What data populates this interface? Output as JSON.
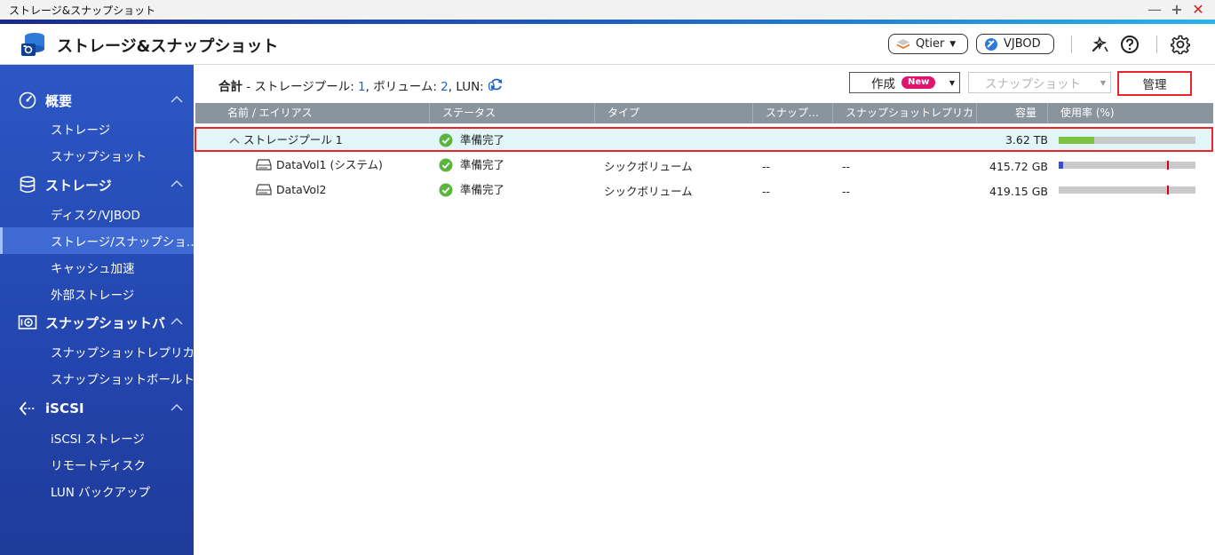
{
  "window": {
    "title": "ストレージ&スナップショット",
    "controls": [
      "minimize-icon",
      "maximize-icon",
      "close-icon"
    ]
  },
  "header": {
    "app_title": "ストレージ&スナップショット",
    "qtier_label": "Qtier",
    "vjbod_label": "VJBOD",
    "icons": [
      "app-logo-icon",
      "tools-icon",
      "help-icon",
      "settings-icon"
    ]
  },
  "sidebar": {
    "sections": [
      {
        "label": "概要",
        "icon": "gauge-icon",
        "items": [
          "ストレージ",
          "スナップショット"
        ]
      },
      {
        "label": "ストレージ",
        "icon": "database-icon",
        "items": [
          "ディスク/VJBOD",
          "ストレージ/スナップショ…",
          "キャッシュ加速",
          "外部ストレージ"
        ]
      },
      {
        "label": "スナップショットバ",
        "icon": "snapshot-vault-icon",
        "items": [
          "スナップショットレプリカ",
          "スナップショットボールト"
        ]
      },
      {
        "label": "iSCSI",
        "icon": "iscsi-icon",
        "items": [
          "iSCSI ストレージ",
          "リモートディスク",
          "LUN バックアップ"
        ]
      }
    ],
    "active_item": "ストレージ/スナップショ…"
  },
  "toolbar": {
    "summary_title": "合計",
    "summary_dash": " - ",
    "pool_label": "ストレージプール: ",
    "pool_count": "1",
    "volume_label": ", ボリューム: ",
    "volume_count": "2",
    "lun_label": ", LUN: ",
    "lun_count": "0",
    "create_label": "作成",
    "new_badge": "New",
    "snapshot_label": "スナップショット",
    "manage_label": "管理"
  },
  "table": {
    "columns": [
      "名前 / エイリアス",
      "ステータス",
      "タイプ",
      "スナップ…",
      "スナップショットレプリカ",
      "容量",
      "使用率 (%)"
    ],
    "rows": [
      {
        "kind": "pool",
        "name": "ストレージプール 1",
        "status": "準備完了",
        "type": "",
        "snapshot": "",
        "replica": "",
        "capacity": "3.62 TB",
        "usage": 0.26
      },
      {
        "kind": "volume",
        "name": "DataVol1 (システム)",
        "status": "準備完了",
        "type": "シックボリューム",
        "snapshot": "--",
        "replica": "--",
        "capacity": "415.72 GB",
        "usage": 0.03
      },
      {
        "kind": "volume",
        "name": "DataVol2",
        "status": "準備完了",
        "type": "シックボリューム",
        "snapshot": "--",
        "replica": "--",
        "capacity": "419.15 GB",
        "usage": 0.0
      }
    ]
  },
  "colors": {
    "accent": "#1e63c8",
    "sidebar_top": "#2c57c4",
    "sidebar_bottom": "#1f3b9a",
    "status_ok": "#5ab43e",
    "usage_pool": "#7cc242",
    "usage_volume": "#3b4fc4",
    "highlight": "#e8262b",
    "badge_new": "#e2136e"
  }
}
